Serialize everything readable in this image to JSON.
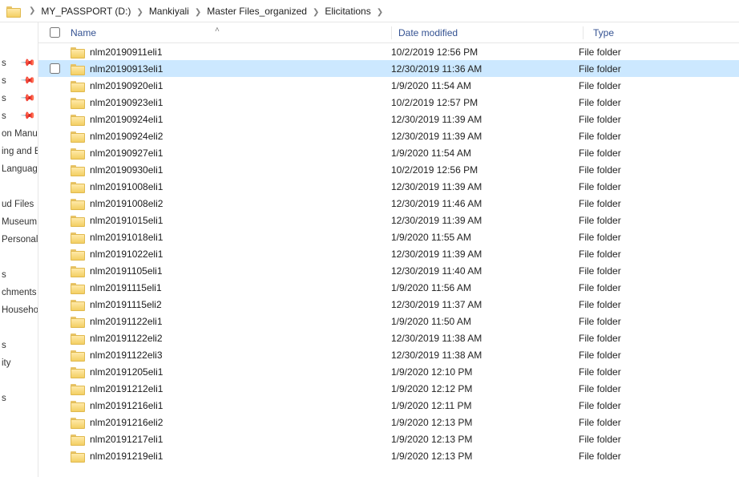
{
  "breadcrumb": {
    "items": [
      {
        "label": "MY_PASSPORT (D:)"
      },
      {
        "label": "Mankiyali"
      },
      {
        "label": "Master Files_organized"
      },
      {
        "label": "Elicitations"
      }
    ]
  },
  "columns": {
    "name": "Name",
    "date": "Date modified",
    "type": "Type"
  },
  "sidebar": {
    "items": [
      {
        "label": "s",
        "pinned": true
      },
      {
        "label": "s",
        "pinned": true
      },
      {
        "label": "s",
        "pinned": true
      },
      {
        "label": "s",
        "pinned": true
      },
      {
        "label": "on Manu",
        "pinned": false
      },
      {
        "label": "ing and B",
        "pinned": false
      },
      {
        "label": "Language",
        "pinned": false
      },
      {
        "label": "",
        "pinned": false
      },
      {
        "label": "ud Files",
        "pinned": false
      },
      {
        "label": "Museum",
        "pinned": false
      },
      {
        "label": "Personal",
        "pinned": false
      },
      {
        "label": "",
        "pinned": false
      },
      {
        "label": "s",
        "pinned": false
      },
      {
        "label": "chments",
        "pinned": false
      },
      {
        "label": "Household",
        "pinned": false
      },
      {
        "label": "",
        "pinned": false
      },
      {
        "label": "s",
        "pinned": false
      },
      {
        "label": "ity",
        "pinned": false
      },
      {
        "label": "",
        "pinned": false
      },
      {
        "label": "s",
        "pinned": false
      }
    ]
  },
  "rows": [
    {
      "name": "nlm20190911eli1",
      "date": "10/2/2019 12:56 PM",
      "type": "File folder",
      "selected": false
    },
    {
      "name": "nlm20190913eli1",
      "date": "12/30/2019 11:36 AM",
      "type": "File folder",
      "selected": true
    },
    {
      "name": "nlm20190920eli1",
      "date": "1/9/2020 11:54 AM",
      "type": "File folder",
      "selected": false
    },
    {
      "name": "nlm20190923eli1",
      "date": "10/2/2019 12:57 PM",
      "type": "File folder",
      "selected": false
    },
    {
      "name": "nlm20190924eli1",
      "date": "12/30/2019 11:39 AM",
      "type": "File folder",
      "selected": false
    },
    {
      "name": "nlm20190924eli2",
      "date": "12/30/2019 11:39 AM",
      "type": "File folder",
      "selected": false
    },
    {
      "name": "nlm20190927eli1",
      "date": "1/9/2020 11:54 AM",
      "type": "File folder",
      "selected": false
    },
    {
      "name": "nlm20190930eli1",
      "date": "10/2/2019 12:56 PM",
      "type": "File folder",
      "selected": false
    },
    {
      "name": "nlm20191008eli1",
      "date": "12/30/2019 11:39 AM",
      "type": "File folder",
      "selected": false
    },
    {
      "name": "nlm20191008eli2",
      "date": "12/30/2019 11:46 AM",
      "type": "File folder",
      "selected": false
    },
    {
      "name": "nlm20191015eli1",
      "date": "12/30/2019 11:39 AM",
      "type": "File folder",
      "selected": false
    },
    {
      "name": "nlm20191018eli1",
      "date": "1/9/2020 11:55 AM",
      "type": "File folder",
      "selected": false
    },
    {
      "name": "nlm20191022eli1",
      "date": "12/30/2019 11:39 AM",
      "type": "File folder",
      "selected": false
    },
    {
      "name": "nlm20191105eli1",
      "date": "12/30/2019 11:40 AM",
      "type": "File folder",
      "selected": false
    },
    {
      "name": "nlm20191115eli1",
      "date": "1/9/2020 11:56 AM",
      "type": "File folder",
      "selected": false
    },
    {
      "name": "nlm20191115eli2",
      "date": "12/30/2019 11:37 AM",
      "type": "File folder",
      "selected": false
    },
    {
      "name": "nlm20191122eli1",
      "date": "1/9/2020 11:50 AM",
      "type": "File folder",
      "selected": false
    },
    {
      "name": "nlm20191122eli2",
      "date": "12/30/2019 11:38 AM",
      "type": "File folder",
      "selected": false
    },
    {
      "name": "nlm20191122eli3",
      "date": "12/30/2019 11:38 AM",
      "type": "File folder",
      "selected": false
    },
    {
      "name": "nlm20191205eli1",
      "date": "1/9/2020 12:10 PM",
      "type": "File folder",
      "selected": false
    },
    {
      "name": "nlm20191212eli1",
      "date": "1/9/2020 12:12 PM",
      "type": "File folder",
      "selected": false
    },
    {
      "name": "nlm20191216eli1",
      "date": "1/9/2020 12:11 PM",
      "type": "File folder",
      "selected": false
    },
    {
      "name": "nlm20191216eli2",
      "date": "1/9/2020 12:13 PM",
      "type": "File folder",
      "selected": false
    },
    {
      "name": "nlm20191217eli1",
      "date": "1/9/2020 12:13 PM",
      "type": "File folder",
      "selected": false
    },
    {
      "name": "nlm20191219eli1",
      "date": "1/9/2020 12:13 PM",
      "type": "File folder",
      "selected": false
    }
  ]
}
